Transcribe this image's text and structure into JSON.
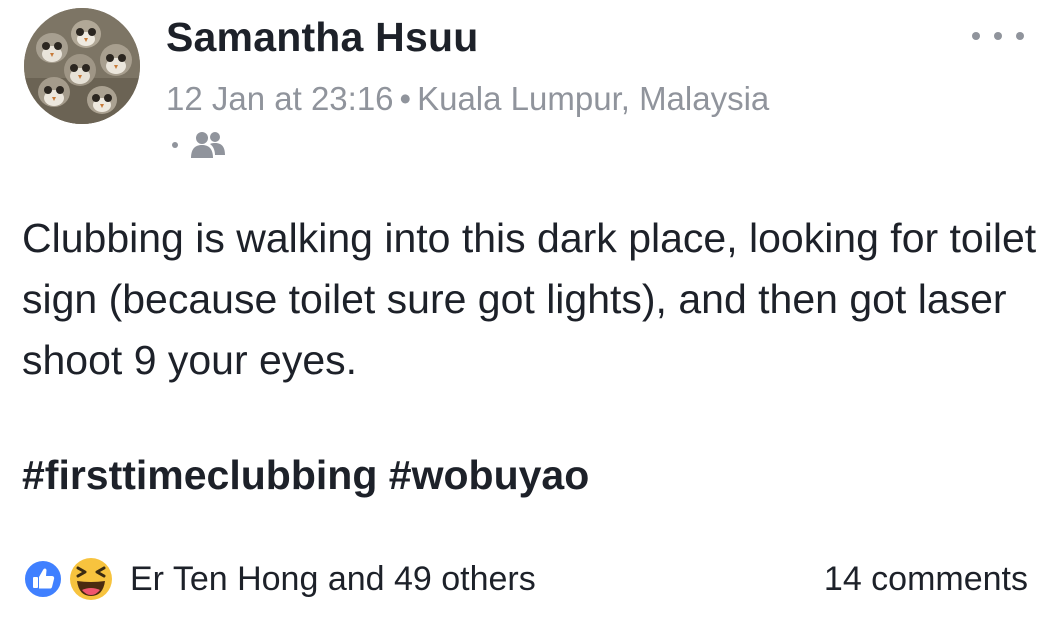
{
  "post": {
    "author": "Samantha Hsuu",
    "timestamp": "12 Jan at 23:16",
    "separator": "•",
    "location": "Kuala Lumpur, Malaysia",
    "audience_icon": "friends-icon",
    "more_icon": "more-options-icon",
    "avatar_icon": "porg-avatar",
    "text": "Clubbing is walking into this dark place, looking for toilet sign (because toilet sure got lights), and then got laser shoot 9 your eyes.",
    "hashtags": [
      "#firsttimeclubbing",
      "#wobuyao"
    ]
  },
  "footer": {
    "reaction_icons": [
      "like-icon",
      "haha-icon"
    ],
    "reactors": "Er Ten Hong and 49 others",
    "comments": "14 comments"
  },
  "colors": {
    "text_primary": "#1d2129",
    "text_secondary": "#90949c",
    "like_blue": "#4080ff",
    "haha_yellow": "#f7c33e"
  }
}
